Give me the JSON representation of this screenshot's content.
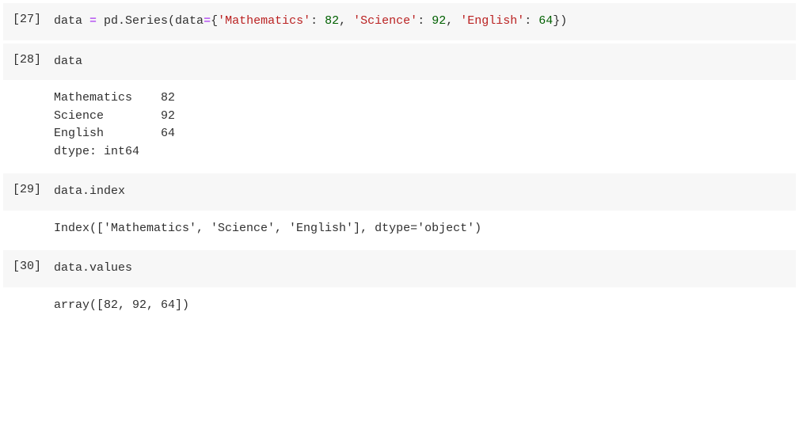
{
  "cells": [
    {
      "prompt": "[27]",
      "code_segments": [
        {
          "t": "data ",
          "c": ""
        },
        {
          "t": "=",
          "c": "op"
        },
        {
          "t": " pd.Series(data",
          "c": ""
        },
        {
          "t": "=",
          "c": "op"
        },
        {
          "t": "{",
          "c": ""
        },
        {
          "t": "'Mathematics'",
          "c": "str"
        },
        {
          "t": ": ",
          "c": ""
        },
        {
          "t": "82",
          "c": "num"
        },
        {
          "t": ", ",
          "c": ""
        },
        {
          "t": "'Science'",
          "c": "str"
        },
        {
          "t": ": ",
          "c": ""
        },
        {
          "t": "92",
          "c": "num"
        },
        {
          "t": ", ",
          "c": ""
        },
        {
          "t": "'English'",
          "c": "str"
        },
        {
          "t": ": ",
          "c": ""
        },
        {
          "t": "64",
          "c": "num"
        },
        {
          "t": "})",
          "c": ""
        }
      ],
      "output": null
    },
    {
      "prompt": "[28]",
      "code_segments": [
        {
          "t": "data",
          "c": ""
        }
      ],
      "output": "Mathematics    82\nScience        92\nEnglish        64\ndtype: int64"
    },
    {
      "prompt": "[29]",
      "code_segments": [
        {
          "t": "data.index",
          "c": ""
        }
      ],
      "output": "Index(['Mathematics', 'Science', 'English'], dtype='object')"
    },
    {
      "prompt": "[30]",
      "code_segments": [
        {
          "t": "data.values",
          "c": ""
        }
      ],
      "output": "array([82, 92, 64])"
    }
  ]
}
